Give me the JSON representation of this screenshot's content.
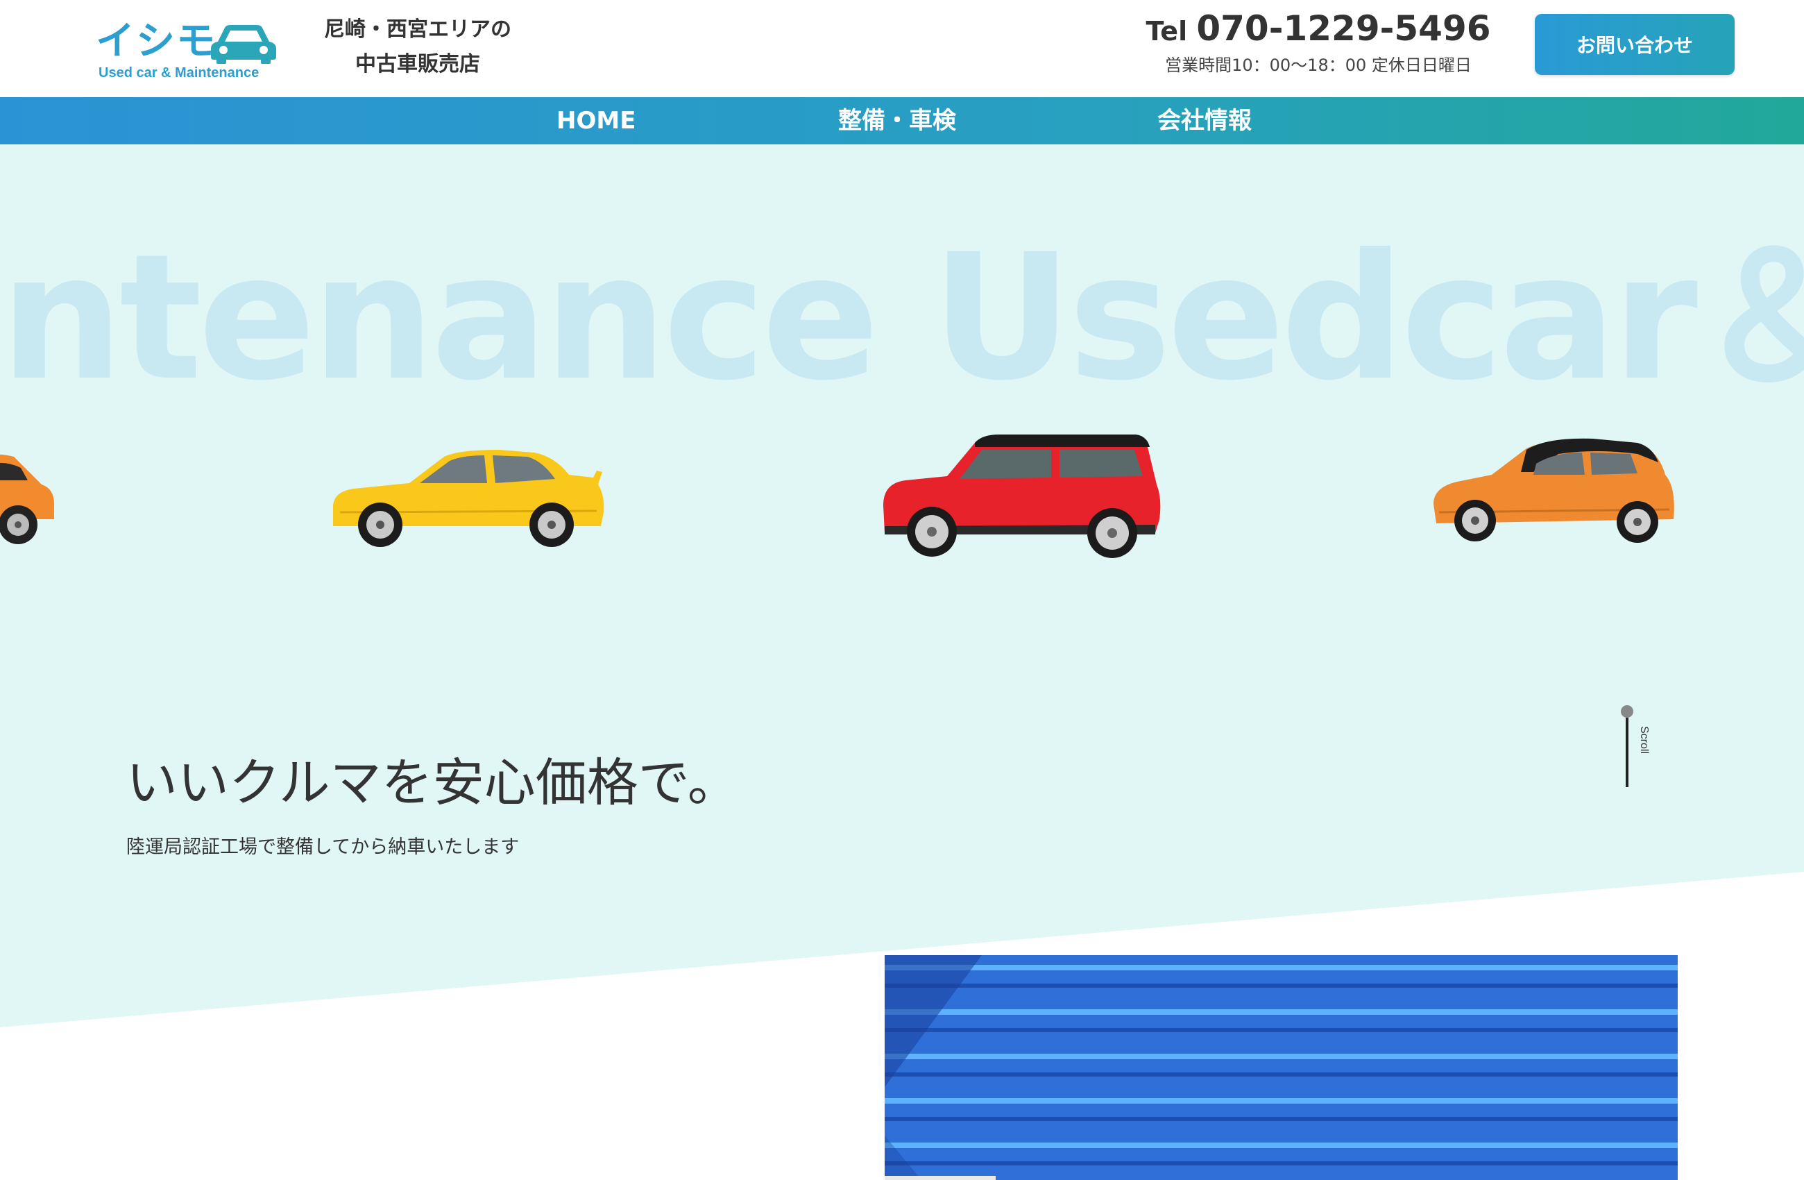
{
  "header": {
    "logo_jp": "イシモ",
    "logo_en": "Used car & Maintenance",
    "tagline_line1": "尼崎・西宮エリアの",
    "tagline_line2": "中古車販売店",
    "tel_label": "Tel ",
    "tel_number": "070-1229-5496",
    "hours": "営業時間10：00〜18：00 定休日日曜日",
    "contact_label": "お問い合わせ"
  },
  "nav": {
    "items": [
      {
        "label": "HOME"
      },
      {
        "label": "整備・車検"
      },
      {
        "label": "会社情報"
      }
    ]
  },
  "hero": {
    "background_text": "ntenance Usedcar＆M",
    "headline": "いいクルマを安心価格で。",
    "subline": "陸運局認証工場で整備してから納車いたします",
    "scroll_label": "Scroll"
  },
  "colors": {
    "brand_blue": "#2a9fd0",
    "hero_bg": "#e1f7f6",
    "bg_text": "#c8e8f2",
    "nav_gradient_start": "#2a93d5",
    "nav_gradient_end": "#22a89a"
  }
}
